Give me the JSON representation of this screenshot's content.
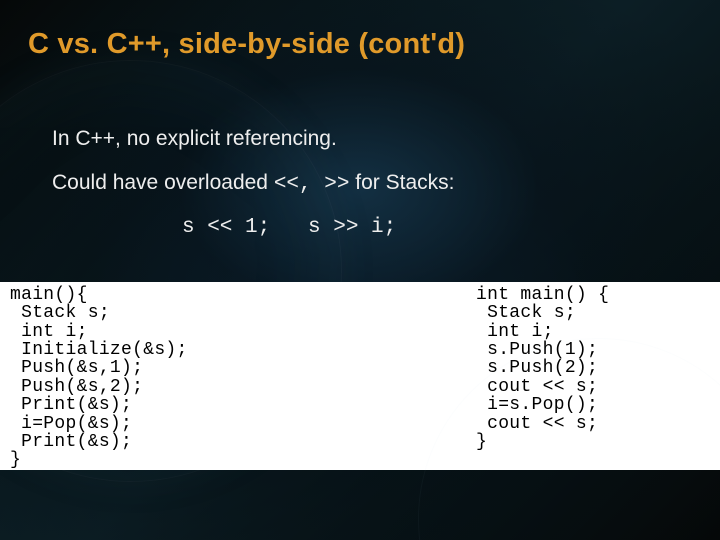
{
  "title": "C vs. C++,  side-by-side (cont'd)",
  "body": {
    "line1": "In C++, no explicit referencing.",
    "line2_pre": "Could have overloaded ",
    "line2_ops": "<<, >>",
    "line2_post": "  for Stacks:",
    "example": "s << 1;   s >> i;"
  },
  "code": {
    "c": "main(){\n Stack s;\n int i;\n Initialize(&s);\n Push(&s,1);\n Push(&s,2);\n Print(&s);\n i=Pop(&s);\n Print(&s);\n}",
    "cpp": "int main() {\n Stack s;\n int i;\n s.Push(1);\n s.Push(2);\n cout << s;\n i=s.Pop();\n cout << s;\n}"
  }
}
